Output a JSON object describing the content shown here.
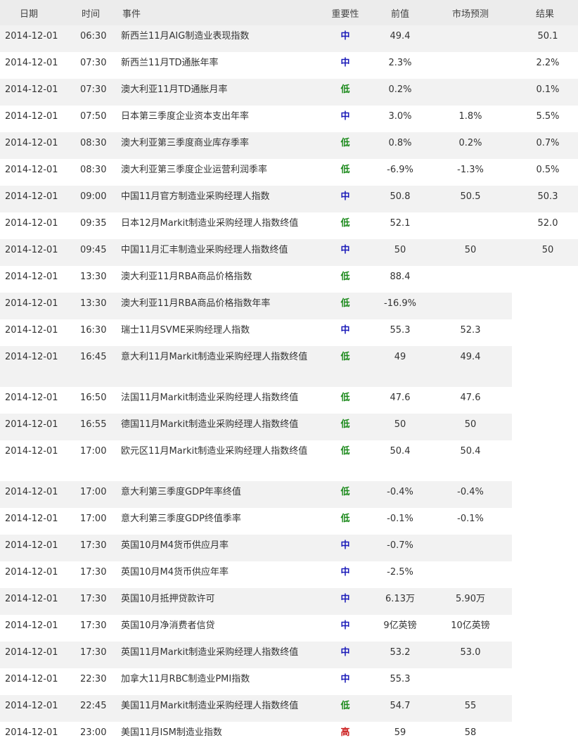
{
  "colors": {
    "mid": "#1a1ab8",
    "low": "#1c8a1c",
    "high": "#cc2020"
  },
  "header": {
    "date": "日期",
    "time": "时间",
    "event": "事件",
    "importance": "重要性",
    "previous": "前值",
    "forecast": "市场预测",
    "result": "结果"
  },
  "rows": [
    {
      "date": "2014-12-01",
      "time": "06:30",
      "event": "新西兰11月AIG制造业表现指数",
      "importance": "中",
      "level": "mid",
      "previous": "49.4",
      "forecast": "",
      "result": "50.1"
    },
    {
      "date": "2014-12-01",
      "time": "07:30",
      "event": "新西兰11月TD通胀年率",
      "importance": "中",
      "level": "mid",
      "previous": "2.3%",
      "forecast": "",
      "result": "2.2%"
    },
    {
      "date": "2014-12-01",
      "time": "07:30",
      "event": "澳大利亚11月TD通胀月率",
      "importance": "低",
      "level": "low",
      "previous": "0.2%",
      "forecast": "",
      "result": "0.1%"
    },
    {
      "date": "2014-12-01",
      "time": "07:50",
      "event": "日本第三季度企业资本支出年率",
      "importance": "中",
      "level": "mid",
      "previous": "3.0%",
      "forecast": "1.8%",
      "result": "5.5%"
    },
    {
      "date": "2014-12-01",
      "time": "08:30",
      "event": "澳大利亚第三季度商业库存季率",
      "importance": "低",
      "level": "low",
      "previous": "0.8%",
      "forecast": "0.2%",
      "result": "0.7%"
    },
    {
      "date": "2014-12-01",
      "time": "08:30",
      "event": "澳大利亚第三季度企业运营利润季率",
      "importance": "低",
      "level": "low",
      "previous": "-6.9%",
      "forecast": "-1.3%",
      "result": "0.5%"
    },
    {
      "date": "2014-12-01",
      "time": "09:00",
      "event": "中国11月官方制造业采购经理人指数",
      "importance": "中",
      "level": "mid",
      "previous": "50.8",
      "forecast": "50.5",
      "result": "50.3"
    },
    {
      "date": "2014-12-01",
      "time": "09:35",
      "event": "日本12月Markit制造业采购经理人指数终值",
      "importance": "低",
      "level": "low",
      "previous": "52.1",
      "forecast": "",
      "result": "52.0"
    },
    {
      "date": "2014-12-01",
      "time": "09:45",
      "event": "中国11月汇丰制造业采购经理人指数终值",
      "importance": "中",
      "level": "mid",
      "previous": "50",
      "forecast": "50",
      "result": "50"
    },
    {
      "date": "2014-12-01",
      "time": "13:30",
      "event": "澳大利亚11月RBA商品价格指数",
      "importance": "低",
      "level": "low",
      "previous": "88.4",
      "forecast": ""
    },
    {
      "date": "2014-12-01",
      "time": "13:30",
      "event": "澳大利亚11月RBA商品价格指数年率",
      "importance": "低",
      "level": "low",
      "previous": "-16.9%",
      "forecast": ""
    },
    {
      "date": "2014-12-01",
      "time": "16:30",
      "event": "瑞士11月SVME采购经理人指数",
      "importance": "中",
      "level": "mid",
      "previous": "55.3",
      "forecast": "52.3"
    },
    {
      "date": "2014-12-01",
      "time": "16:45",
      "event": "意大利11月Markit制造业采购经理人指数终值",
      "importance": "低",
      "level": "low",
      "previous": "49",
      "forecast": "49.4",
      "tall": true
    },
    {
      "date": "2014-12-01",
      "time": "16:50",
      "event": "法国11月Markit制造业采购经理人指数终值",
      "importance": "低",
      "level": "low",
      "previous": "47.6",
      "forecast": "47.6"
    },
    {
      "date": "2014-12-01",
      "time": "16:55",
      "event": "德国11月Markit制造业采购经理人指数终值",
      "importance": "低",
      "level": "low",
      "previous": "50",
      "forecast": "50"
    },
    {
      "date": "2014-12-01",
      "time": "17:00",
      "event": "欧元区11月Markit制造业采购经理人指数终值",
      "importance": "低",
      "level": "low",
      "previous": "50.4",
      "forecast": "50.4",
      "tall": true
    },
    {
      "date": "2014-12-01",
      "time": "17:00",
      "event": "意大利第三季度GDP年率终值",
      "importance": "低",
      "level": "low",
      "previous": "-0.4%",
      "forecast": "-0.4%"
    },
    {
      "date": "2014-12-01",
      "time": "17:00",
      "event": "意大利第三季度GDP终值季率",
      "importance": "低",
      "level": "low",
      "previous": "-0.1%",
      "forecast": "-0.1%"
    },
    {
      "date": "2014-12-01",
      "time": "17:30",
      "event": "英国10月M4货币供应月率",
      "importance": "中",
      "level": "mid",
      "previous": "-0.7%",
      "forecast": ""
    },
    {
      "date": "2014-12-01",
      "time": "17:30",
      "event": "英国10月M4货币供应年率",
      "importance": "中",
      "level": "mid",
      "previous": "-2.5%",
      "forecast": ""
    },
    {
      "date": "2014-12-01",
      "time": "17:30",
      "event": "英国10月抵押贷款许可",
      "importance": "中",
      "level": "mid",
      "previous": "6.13万",
      "forecast": "5.90万"
    },
    {
      "date": "2014-12-01",
      "time": "17:30",
      "event": "英国10月净消费者信贷",
      "importance": "中",
      "level": "mid",
      "previous": "9亿英镑",
      "forecast": "10亿英镑"
    },
    {
      "date": "2014-12-01",
      "time": "17:30",
      "event": "英国11月Markit制造业采购经理人指数终值",
      "importance": "中",
      "level": "mid",
      "previous": "53.2",
      "forecast": "53.0"
    },
    {
      "date": "2014-12-01",
      "time": "22:30",
      "event": "加拿大11月RBC制造业PMI指数",
      "importance": "中",
      "level": "mid",
      "previous": "55.3",
      "forecast": ""
    },
    {
      "date": "2014-12-01",
      "time": "22:45",
      "event": "美国11月Markit制造业采购经理人指数终值",
      "importance": "低",
      "level": "low",
      "previous": "54.7",
      "forecast": "55"
    },
    {
      "date": "2014-12-01",
      "time": "23:00",
      "event": "美国11月ISM制造业指数",
      "importance": "高",
      "level": "high",
      "previous": "59",
      "forecast": "58"
    }
  ]
}
